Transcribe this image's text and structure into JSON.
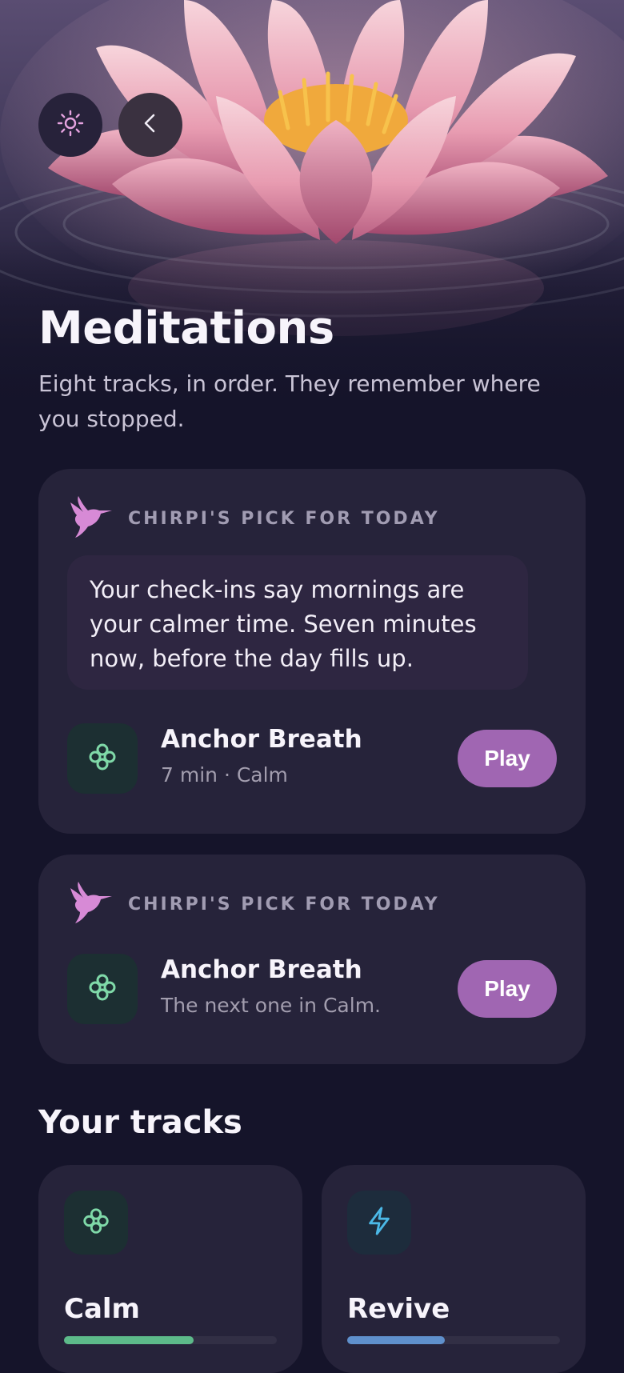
{
  "page": {
    "title": "Meditations",
    "subtitle": "Eight tracks, in order. They remember where you stopped."
  },
  "header": {
    "theme_icon": "sun-icon",
    "back_icon": "chevron-left-icon"
  },
  "pick_card": {
    "label": "CHIRPI'S PICK FOR TODAY",
    "message": "Your check-ins say mornings are your calmer time. Seven minutes now, before the day fills up.",
    "track": {
      "name": "Anchor Breath",
      "meta": "7 min · Calm",
      "icon": "clover-icon",
      "play_label": "Play"
    }
  },
  "next_card": {
    "label": "CHIRPI'S PICK FOR TODAY",
    "track": {
      "name": "Anchor Breath",
      "meta": "The next one in Calm.",
      "icon": "clover-icon",
      "play_label": "Play"
    }
  },
  "tracks_section": {
    "title": "Your tracks",
    "tracks": [
      {
        "name": "Calm",
        "icon": "clover-icon",
        "progress": 0.61,
        "color": "#5dba8a"
      },
      {
        "name": "Revive",
        "icon": "lightning-icon",
        "progress": 0.46,
        "color": "#5f90cc"
      }
    ]
  },
  "colors": {
    "background": "#15142a",
    "card": "#26233a",
    "accent": "#a066b2",
    "calm_green": "#7fd9a8",
    "revive_blue": "#4bb8e6",
    "hummingbird": "#d78ad6"
  }
}
